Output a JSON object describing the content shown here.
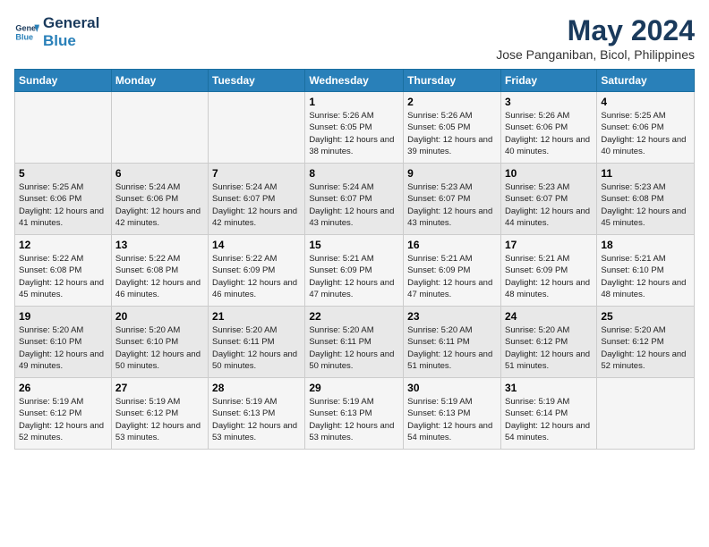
{
  "logo": {
    "line1": "General",
    "line2": "Blue"
  },
  "title": "May 2024",
  "location": "Jose Panganiban, Bicol, Philippines",
  "days_of_week": [
    "Sunday",
    "Monday",
    "Tuesday",
    "Wednesday",
    "Thursday",
    "Friday",
    "Saturday"
  ],
  "weeks": [
    [
      {
        "day": "",
        "info": ""
      },
      {
        "day": "",
        "info": ""
      },
      {
        "day": "",
        "info": ""
      },
      {
        "day": "1",
        "info": "Sunrise: 5:26 AM\nSunset: 6:05 PM\nDaylight: 12 hours and 38 minutes."
      },
      {
        "day": "2",
        "info": "Sunrise: 5:26 AM\nSunset: 6:05 PM\nDaylight: 12 hours and 39 minutes."
      },
      {
        "day": "3",
        "info": "Sunrise: 5:26 AM\nSunset: 6:06 PM\nDaylight: 12 hours and 40 minutes."
      },
      {
        "day": "4",
        "info": "Sunrise: 5:25 AM\nSunset: 6:06 PM\nDaylight: 12 hours and 40 minutes."
      }
    ],
    [
      {
        "day": "5",
        "info": "Sunrise: 5:25 AM\nSunset: 6:06 PM\nDaylight: 12 hours and 41 minutes."
      },
      {
        "day": "6",
        "info": "Sunrise: 5:24 AM\nSunset: 6:06 PM\nDaylight: 12 hours and 42 minutes."
      },
      {
        "day": "7",
        "info": "Sunrise: 5:24 AM\nSunset: 6:07 PM\nDaylight: 12 hours and 42 minutes."
      },
      {
        "day": "8",
        "info": "Sunrise: 5:24 AM\nSunset: 6:07 PM\nDaylight: 12 hours and 43 minutes."
      },
      {
        "day": "9",
        "info": "Sunrise: 5:23 AM\nSunset: 6:07 PM\nDaylight: 12 hours and 43 minutes."
      },
      {
        "day": "10",
        "info": "Sunrise: 5:23 AM\nSunset: 6:07 PM\nDaylight: 12 hours and 44 minutes."
      },
      {
        "day": "11",
        "info": "Sunrise: 5:23 AM\nSunset: 6:08 PM\nDaylight: 12 hours and 45 minutes."
      }
    ],
    [
      {
        "day": "12",
        "info": "Sunrise: 5:22 AM\nSunset: 6:08 PM\nDaylight: 12 hours and 45 minutes."
      },
      {
        "day": "13",
        "info": "Sunrise: 5:22 AM\nSunset: 6:08 PM\nDaylight: 12 hours and 46 minutes."
      },
      {
        "day": "14",
        "info": "Sunrise: 5:22 AM\nSunset: 6:09 PM\nDaylight: 12 hours and 46 minutes."
      },
      {
        "day": "15",
        "info": "Sunrise: 5:21 AM\nSunset: 6:09 PM\nDaylight: 12 hours and 47 minutes."
      },
      {
        "day": "16",
        "info": "Sunrise: 5:21 AM\nSunset: 6:09 PM\nDaylight: 12 hours and 47 minutes."
      },
      {
        "day": "17",
        "info": "Sunrise: 5:21 AM\nSunset: 6:09 PM\nDaylight: 12 hours and 48 minutes."
      },
      {
        "day": "18",
        "info": "Sunrise: 5:21 AM\nSunset: 6:10 PM\nDaylight: 12 hours and 48 minutes."
      }
    ],
    [
      {
        "day": "19",
        "info": "Sunrise: 5:20 AM\nSunset: 6:10 PM\nDaylight: 12 hours and 49 minutes."
      },
      {
        "day": "20",
        "info": "Sunrise: 5:20 AM\nSunset: 6:10 PM\nDaylight: 12 hours and 50 minutes."
      },
      {
        "day": "21",
        "info": "Sunrise: 5:20 AM\nSunset: 6:11 PM\nDaylight: 12 hours and 50 minutes."
      },
      {
        "day": "22",
        "info": "Sunrise: 5:20 AM\nSunset: 6:11 PM\nDaylight: 12 hours and 50 minutes."
      },
      {
        "day": "23",
        "info": "Sunrise: 5:20 AM\nSunset: 6:11 PM\nDaylight: 12 hours and 51 minutes."
      },
      {
        "day": "24",
        "info": "Sunrise: 5:20 AM\nSunset: 6:12 PM\nDaylight: 12 hours and 51 minutes."
      },
      {
        "day": "25",
        "info": "Sunrise: 5:20 AM\nSunset: 6:12 PM\nDaylight: 12 hours and 52 minutes."
      }
    ],
    [
      {
        "day": "26",
        "info": "Sunrise: 5:19 AM\nSunset: 6:12 PM\nDaylight: 12 hours and 52 minutes."
      },
      {
        "day": "27",
        "info": "Sunrise: 5:19 AM\nSunset: 6:12 PM\nDaylight: 12 hours and 53 minutes."
      },
      {
        "day": "28",
        "info": "Sunrise: 5:19 AM\nSunset: 6:13 PM\nDaylight: 12 hours and 53 minutes."
      },
      {
        "day": "29",
        "info": "Sunrise: 5:19 AM\nSunset: 6:13 PM\nDaylight: 12 hours and 53 minutes."
      },
      {
        "day": "30",
        "info": "Sunrise: 5:19 AM\nSunset: 6:13 PM\nDaylight: 12 hours and 54 minutes."
      },
      {
        "day": "31",
        "info": "Sunrise: 5:19 AM\nSunset: 6:14 PM\nDaylight: 12 hours and 54 minutes."
      },
      {
        "day": "",
        "info": ""
      }
    ]
  ]
}
